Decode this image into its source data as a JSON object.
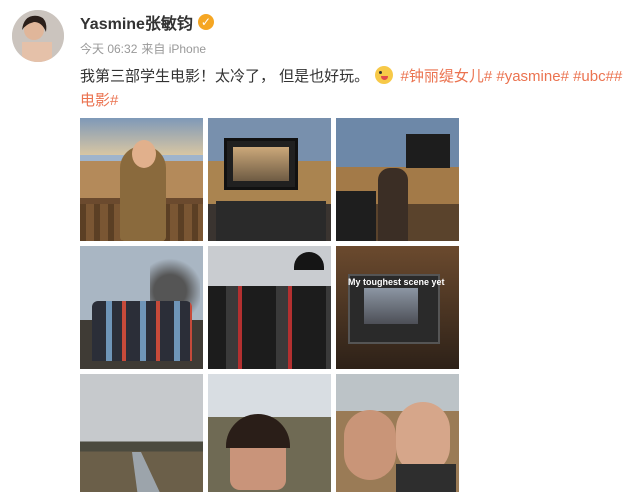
{
  "post": {
    "author": "Yasmine张敏钧",
    "verified_icon": "verified-badge-icon",
    "time": "今天 06:32",
    "source": "来自 iPhone",
    "text_main": "我第三部学生电影！太冷了， 但是也好玩。",
    "emoji": "laughing-face-emoji",
    "topic_1": "#钟丽缇女儿#",
    "topic_2": "#yasmine#",
    "topic_3": "#ubc##电影#"
  },
  "photos": {
    "overlay_text": "My toughest scene yet"
  },
  "colors": {
    "topic": "#eb7350",
    "verified": "#f5a623",
    "meta": "#999999"
  }
}
